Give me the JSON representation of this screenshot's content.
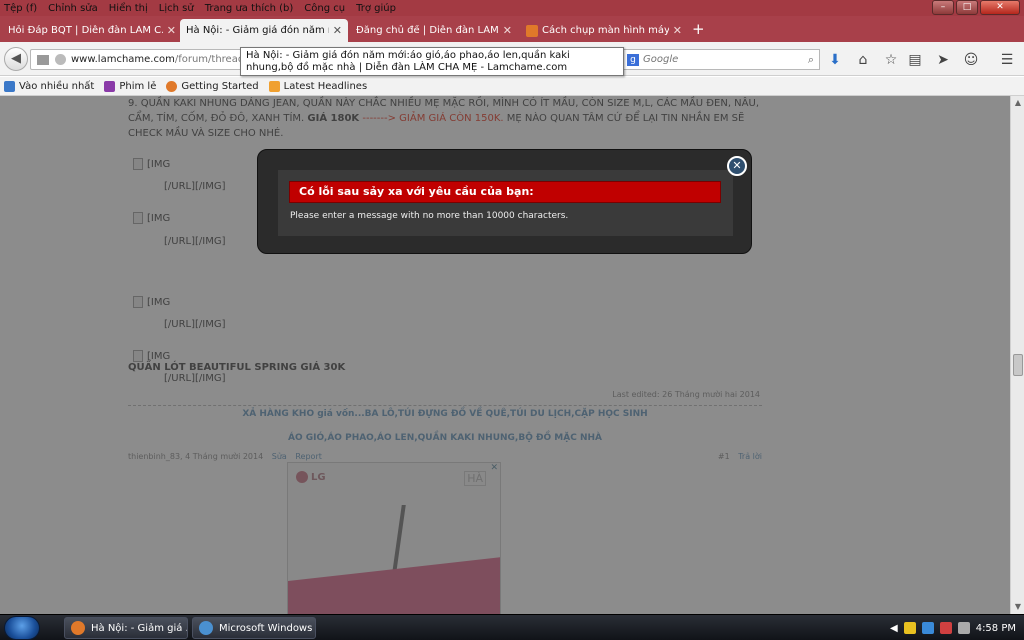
{
  "menubar": {
    "items": [
      "Tệp (f)",
      "Chỉnh sửa",
      "Hiển thị",
      "Lịch sử",
      "Trang ưa thích (b)",
      "Công cụ",
      "Trợ giúp"
    ]
  },
  "window_controls": {
    "minimize": "–",
    "maximize": "□",
    "close": "✕"
  },
  "tabs": [
    {
      "label": "Hỏi Đáp BQT | Diễn đàn LÀM C...",
      "active": false
    },
    {
      "label": "Hà Nội: - Giảm giá đón năm m...",
      "active": true
    },
    {
      "label": "Đăng chủ đề | Diễn đàn LÀM C...",
      "active": false
    },
    {
      "label": "Cách chụp màn hình máy ...",
      "active": false
    }
  ],
  "new_tab": "+",
  "tab_close": "✕",
  "navbar": {
    "url_host": "www.lamchame.com",
    "url_path": "/forum/threads/gi",
    "search_placeholder": "Google",
    "search_engine_icon": "g"
  },
  "tooltip": "Hà Nội: - Giảm giá đón năm mới:áo gió,áo phao,áo len,quần kaki nhung,bộ đồ mặc nhà | Diễn đàn LÀM CHA MẸ - Lamchame.com",
  "bookmarks": [
    {
      "label": "Vào nhiều nhất",
      "color": "#3a78c8"
    },
    {
      "label": "Phim lẻ",
      "color": "#8a3aa8"
    },
    {
      "label": "Getting Started",
      "color": "#e0792a"
    },
    {
      "label": "Latest Headlines",
      "color": "#f0a030"
    }
  ],
  "post": {
    "item9_a": "9. QUẦN KAKI NHUNG DÁNG JEAN, QUẦN NÀY CHẮC NHIỀU MẸ MẶC RỒI, MÌNH CÓ ÍT MẦU, CÒN SIZE M,L, CÁC MẦU ĐEN, NÂU, CẨM, TÍM, CỐM, ĐỎ ĐÔ, XANH TÍM.",
    "item9_price": "GIÁ 180K",
    "item9_sale": "-------> GIẢM GIÁ CÒN 150K.",
    "item9_b": "MẸ NÀO QUAN TÂM CỨ ĐỂ LẠI TIN NHẮN EM SẼ CHECK MẦU VÀ SIZE CHO NHÉ.",
    "img_tag": "[IMG",
    "url_img_tag": "[/URL][/IMG]",
    "heading2": "QUẦN LÓT BEAUTIFUL SPRING GIÁ 30K",
    "last_edited": "Last edited: 26 Tháng mười hai 2014",
    "sig_line1": "XẢ HÀNG KHO giá vốn...BA LÔ,TÚI ĐỰNG ĐỒ VỀ QUÊ,TÚI DU LỊCH,CẶP HỌC SINH",
    "sig_line2": "ÁO GIÓ,ÁO PHAO,ÁO LEN,QUẦN KAKI NHUNG,BỘ ĐỒ MẶC NHÀ",
    "meta_author": "thienbinh_83, 4 Tháng mười 2014",
    "meta_edit": "Sửa",
    "meta_report": "Report",
    "meta_num": "#1",
    "meta_reply": "Trả lời"
  },
  "ad": {
    "brand": "LG",
    "corner": "HÀ",
    "close": "✕"
  },
  "modal": {
    "title": "Có lỗi sau sảy xa với yêu cầu của bạn:",
    "message": "Please enter a message with no more than 10000 characters.",
    "close": "✕"
  },
  "taskbar": {
    "tasks": [
      {
        "label": "Hà Nội: - Giảm giá ..."
      },
      {
        "label": "Microsoft Windows"
      }
    ],
    "clock": "4:58 PM"
  },
  "colors": {
    "titlebar": "#a33a43",
    "error_header": "#c00000",
    "modal_bg": "#2b2b2b",
    "signature_link": "#8fb3cf"
  }
}
